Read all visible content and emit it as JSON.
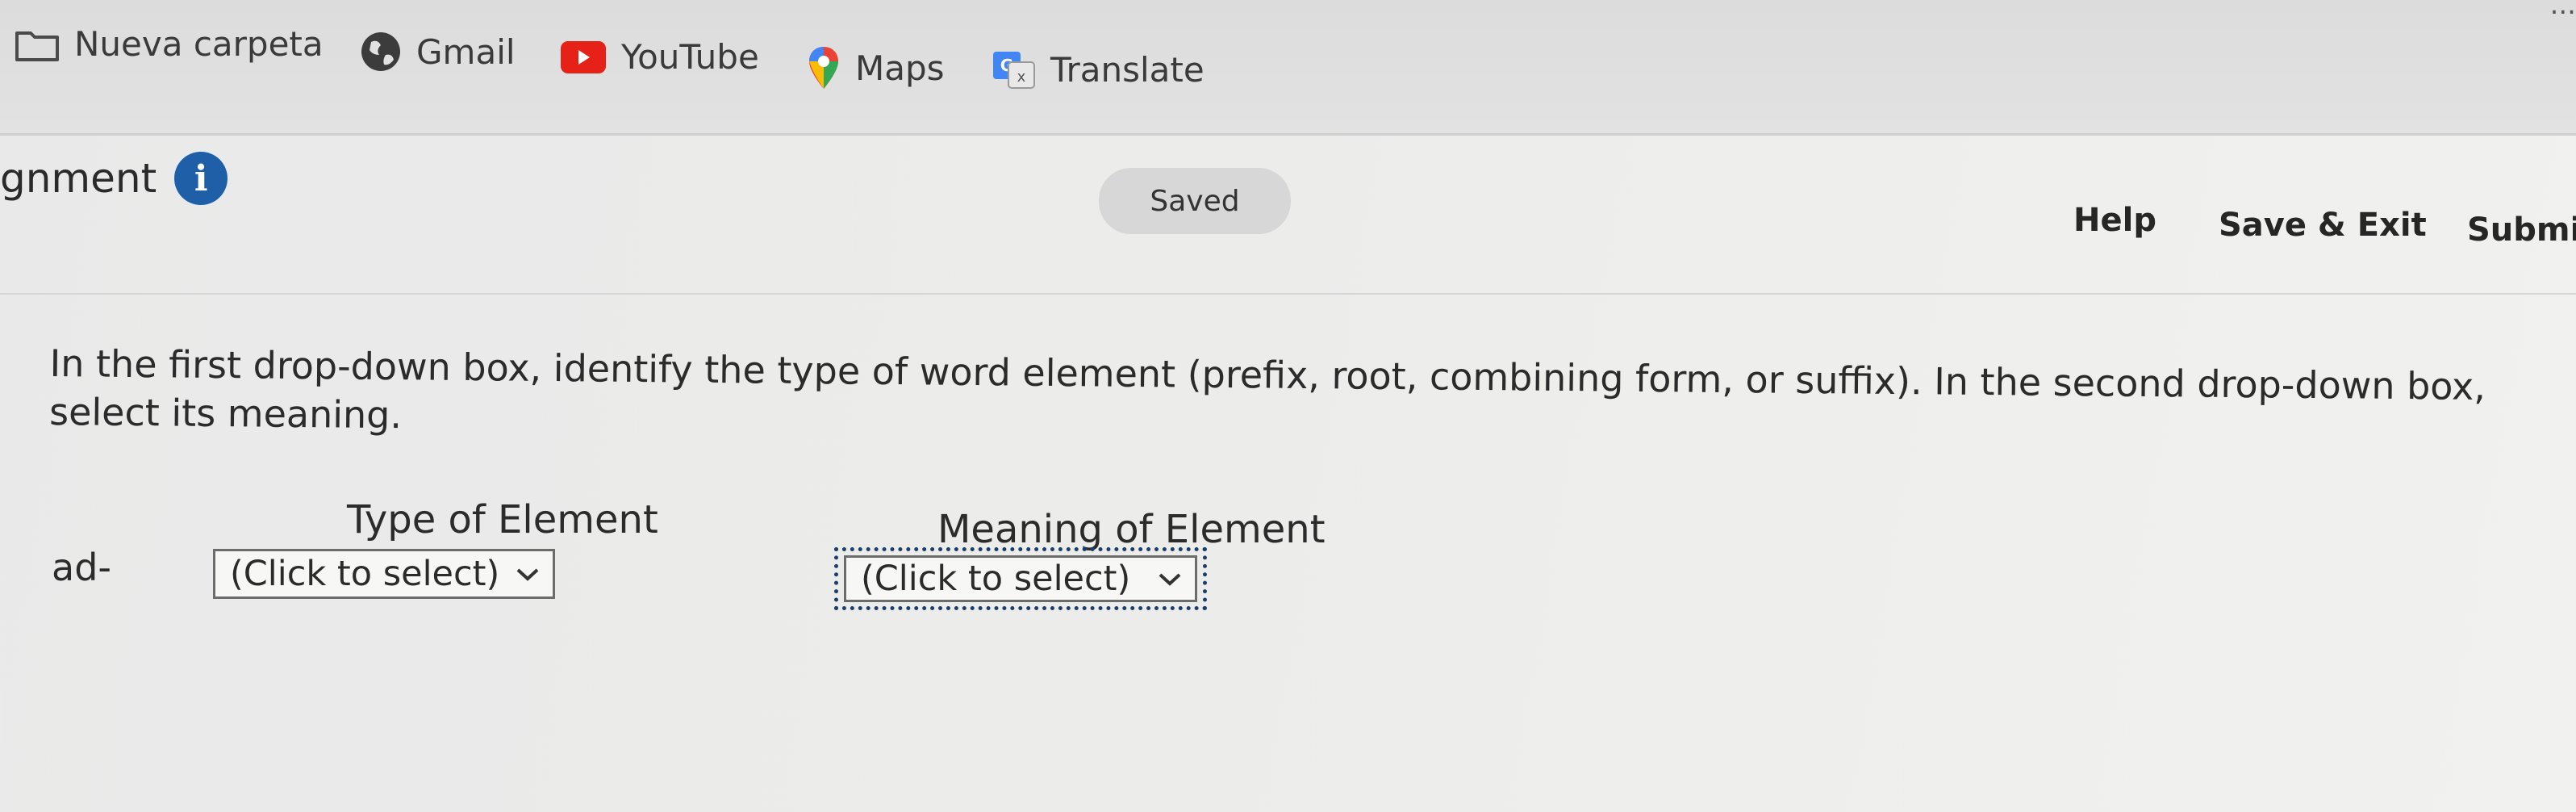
{
  "bookmarks": [
    {
      "label": "Nueva carpeta",
      "icon": "folder-icon"
    },
    {
      "label": "Gmail",
      "icon": "globe-icon"
    },
    {
      "label": "YouTube",
      "icon": "youtube-icon"
    },
    {
      "label": "Maps",
      "icon": "maps-pin-icon"
    },
    {
      "label": "Translate",
      "icon": "translate-icon"
    }
  ],
  "browser": {
    "top_right_overflow": "..."
  },
  "header": {
    "assignment_title_partial": "gnment",
    "saved_status": "Saved",
    "help_label": "Help",
    "save_exit_label": "Save & Exit",
    "submit_label_partial": "Submi"
  },
  "question": {
    "instructions": "In the first drop-down box, identify the type of word element (prefix, root, combining form, or suffix). In the second drop-down box, select its meaning.",
    "type_header": "Type of Element",
    "meaning_header": "Meaning of Element",
    "term": "ad-",
    "type_select_value": "(Click to select)",
    "meaning_select_value": "(Click to select)"
  },
  "colors": {
    "info_icon": "#1f5fa8",
    "youtube_red": "#e62117",
    "focus_outline": "#1b3f6b"
  }
}
